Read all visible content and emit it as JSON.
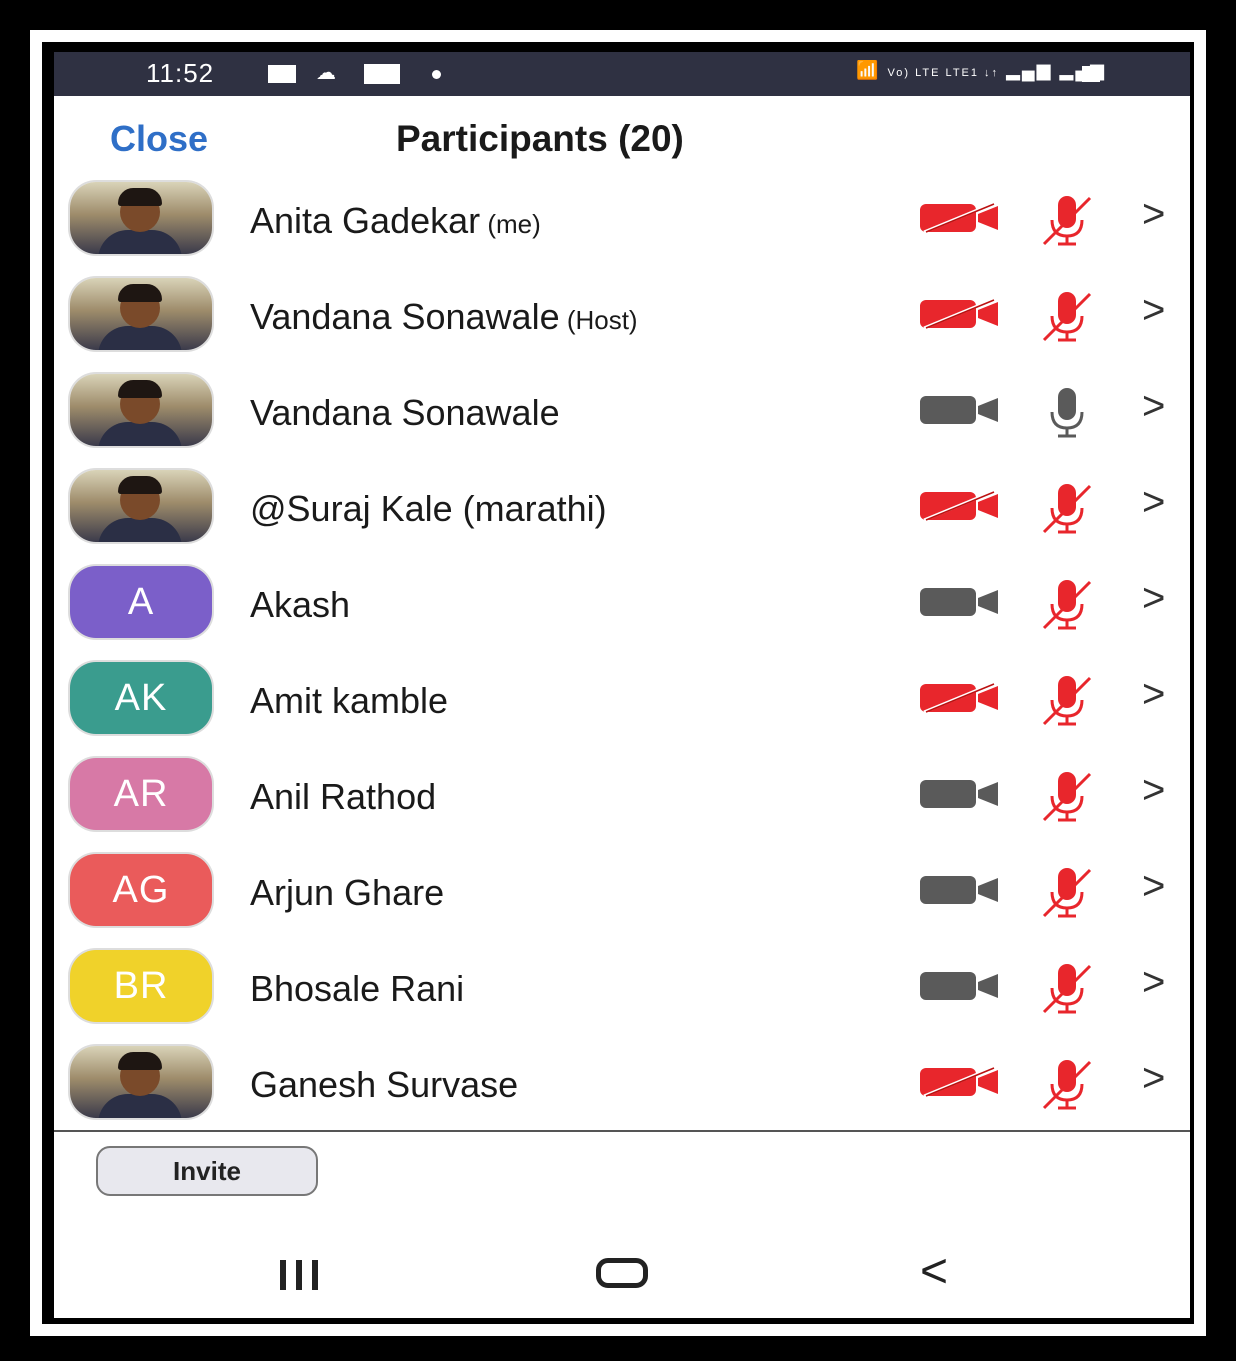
{
  "status_bar": {
    "time": "11:52",
    "right_indicators": "Vo) LTE LTE1 ↓↑"
  },
  "header": {
    "close_label": "Close",
    "title": "Participants (20)"
  },
  "participants": [
    {
      "name": "Anita Gadekar",
      "tag": "(me)",
      "avatar_type": "photo",
      "initials": "",
      "avatar_color": "",
      "video_on": false,
      "mic_on": false
    },
    {
      "name": "Vandana Sonawale",
      "tag": "(Host)",
      "avatar_type": "photo",
      "initials": "",
      "avatar_color": "",
      "video_on": false,
      "mic_on": false
    },
    {
      "name": "Vandana Sonawale",
      "tag": "",
      "avatar_type": "photo",
      "initials": "",
      "avatar_color": "",
      "video_on": true,
      "mic_on": true
    },
    {
      "name": "@Suraj Kale (marathi)",
      "tag": "",
      "avatar_type": "photo",
      "initials": "",
      "avatar_color": "",
      "video_on": false,
      "mic_on": false
    },
    {
      "name": "Akash",
      "tag": "",
      "avatar_type": "initials",
      "initials": "A",
      "avatar_color": "#7b5fc9",
      "video_on": true,
      "mic_on": false
    },
    {
      "name": "Amit kamble",
      "tag": "",
      "avatar_type": "initials",
      "initials": "AK",
      "avatar_color": "#3a9c8e",
      "video_on": false,
      "mic_on": false
    },
    {
      "name": "Anil Rathod",
      "tag": "",
      "avatar_type": "initials",
      "initials": "AR",
      "avatar_color": "#d779a6",
      "video_on": true,
      "mic_on": false
    },
    {
      "name": "Arjun Ghare",
      "tag": "",
      "avatar_type": "initials",
      "initials": "AG",
      "avatar_color": "#ea5b5b",
      "video_on": true,
      "mic_on": false
    },
    {
      "name": "Bhosale Rani",
      "tag": "",
      "avatar_type": "initials",
      "initials": "BR",
      "avatar_color": "#f0d22a",
      "video_on": true,
      "mic_on": false
    },
    {
      "name": "Ganesh Survase",
      "tag": "",
      "avatar_type": "photo",
      "initials": "",
      "avatar_color": "",
      "video_on": false,
      "mic_on": false
    }
  ],
  "footer": {
    "invite_label": "Invite"
  },
  "colors": {
    "muted_red": "#e8262c",
    "active_grey": "#5a5a5a",
    "status_bar_bg": "#2f3142",
    "close_blue": "#2f6fc7"
  },
  "icons": {
    "camera": "video-camera-icon",
    "mic": "microphone-icon",
    "chevron": "chevron-right-icon",
    "nav_recent": "recent-apps-icon",
    "nav_home": "home-icon",
    "nav_back": "back-icon"
  }
}
